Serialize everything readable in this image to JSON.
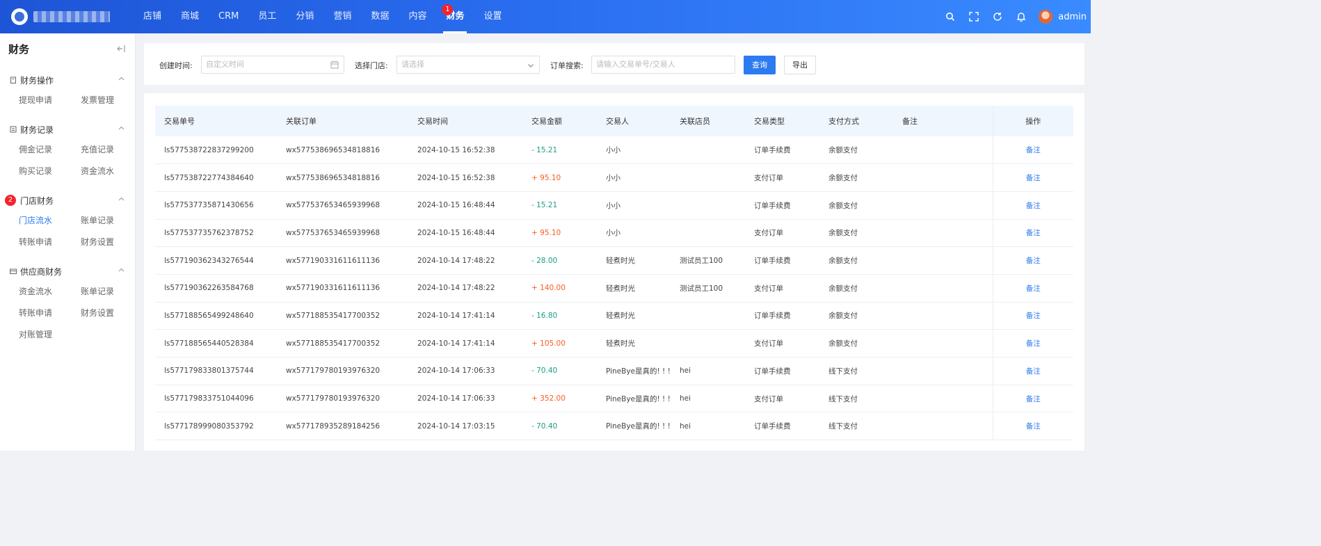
{
  "header": {
    "nav": [
      {
        "label": "店铺",
        "active": false
      },
      {
        "label": "商城",
        "active": false
      },
      {
        "label": "CRM",
        "active": false
      },
      {
        "label": "员工",
        "active": false
      },
      {
        "label": "分销",
        "active": false
      },
      {
        "label": "营销",
        "active": false
      },
      {
        "label": "数据",
        "active": false
      },
      {
        "label": "内容",
        "active": false
      },
      {
        "label": "财务",
        "active": true
      },
      {
        "label": "设置",
        "active": false
      }
    ],
    "nav_badge": "1",
    "username": "admin",
    "icons": [
      "search-icon",
      "fullscreen-icon",
      "refresh-icon",
      "bell-icon"
    ]
  },
  "sidebar": {
    "title": "财务",
    "groups": [
      {
        "label": "财务操作",
        "items": [
          "提现申请",
          "发票管理"
        ]
      },
      {
        "label": "财务记录",
        "items": [
          "佣金记录",
          "充值记录",
          "购买记录",
          "资金流水"
        ]
      },
      {
        "label": "门店财务",
        "badge": "2",
        "items": [
          "门店流水",
          "账单记录",
          "转账申请",
          "财务设置"
        ],
        "active_item": "门店流水"
      },
      {
        "label": "供应商财务",
        "items": [
          "资金流水",
          "账单记录",
          "转账申请",
          "财务设置",
          "对账管理"
        ]
      }
    ]
  },
  "filters": {
    "created_label": "创建时间:",
    "created_placeholder": "自定义时间",
    "store_label": "选择门店:",
    "store_placeholder": "请选择",
    "order_label": "订单搜索:",
    "order_placeholder": "请输入交易单号/交易人",
    "query_button": "查询",
    "export_button": "导出"
  },
  "table": {
    "columns": [
      "交易单号",
      "关联订单",
      "交易时间",
      "交易金额",
      "交易人",
      "关联店员",
      "交易类型",
      "支付方式",
      "备注",
      "操作"
    ],
    "action_label": "备注",
    "rows": [
      {
        "id": "ls577538722837299200",
        "order": "wx577538696534818816",
        "time": "2024-10-15 16:52:38",
        "amount": "- 15.21",
        "sign": "neg",
        "person": "小小",
        "clerk": "",
        "type": "订单手续费",
        "pay": "余额支付",
        "note": ""
      },
      {
        "id": "ls577538722774384640",
        "order": "wx577538696534818816",
        "time": "2024-10-15 16:52:38",
        "amount": "+ 95.10",
        "sign": "pos",
        "person": "小小",
        "clerk": "",
        "type": "支付订单",
        "pay": "余额支付",
        "note": ""
      },
      {
        "id": "ls577537735871430656",
        "order": "wx577537653465939968",
        "time": "2024-10-15 16:48:44",
        "amount": "- 15.21",
        "sign": "neg",
        "person": "小小",
        "clerk": "",
        "type": "订单手续费",
        "pay": "余额支付",
        "note": ""
      },
      {
        "id": "ls577537735762378752",
        "order": "wx577537653465939968",
        "time": "2024-10-15 16:48:44",
        "amount": "+ 95.10",
        "sign": "pos",
        "person": "小小",
        "clerk": "",
        "type": "支付订单",
        "pay": "余额支付",
        "note": ""
      },
      {
        "id": "ls577190362343276544",
        "order": "wx577190331611611136",
        "time": "2024-10-14 17:48:22",
        "amount": "- 28.00",
        "sign": "neg",
        "person": "轻煮时光",
        "clerk": "测试员工100",
        "type": "订单手续费",
        "pay": "余额支付",
        "note": ""
      },
      {
        "id": "ls577190362263584768",
        "order": "wx577190331611611136",
        "time": "2024-10-14 17:48:22",
        "amount": "+ 140.00",
        "sign": "pos",
        "person": "轻煮时光",
        "clerk": "测试员工100",
        "type": "支付订单",
        "pay": "余额支付",
        "note": ""
      },
      {
        "id": "ls577188565499248640",
        "order": "wx577188535417700352",
        "time": "2024-10-14 17:41:14",
        "amount": "- 16.80",
        "sign": "neg",
        "person": "轻煮时光",
        "clerk": "",
        "type": "订单手续费",
        "pay": "余额支付",
        "note": ""
      },
      {
        "id": "ls577188565440528384",
        "order": "wx577188535417700352",
        "time": "2024-10-14 17:41:14",
        "amount": "+ 105.00",
        "sign": "pos",
        "person": "轻煮时光",
        "clerk": "",
        "type": "支付订单",
        "pay": "余额支付",
        "note": ""
      },
      {
        "id": "ls577179833801375744",
        "order": "wx577179780193976320",
        "time": "2024-10-14 17:06:33",
        "amount": "- 70.40",
        "sign": "neg",
        "person": "PineBye是真的! ! !",
        "clerk": "hei",
        "type": "订单手续费",
        "pay": "线下支付",
        "note": ""
      },
      {
        "id": "ls577179833751044096",
        "order": "wx577179780193976320",
        "time": "2024-10-14 17:06:33",
        "amount": "+ 352.00",
        "sign": "pos",
        "person": "PineBye是真的! ! !",
        "clerk": "hei",
        "type": "支付订单",
        "pay": "线下支付",
        "note": ""
      },
      {
        "id": "ls577178999080353792",
        "order": "wx577178935289184256",
        "time": "2024-10-14 17:03:15",
        "amount": "- 70.40",
        "sign": "neg",
        "person": "PineBye是真的! ! !",
        "clerk": "hei",
        "type": "订单手续费",
        "pay": "线下支付",
        "note": ""
      }
    ]
  },
  "colors": {
    "primary": "#2d7bf0",
    "negative_amount": "#1a9c84",
    "positive_amount": "#ff5a1f",
    "badge": "#f5222d"
  }
}
